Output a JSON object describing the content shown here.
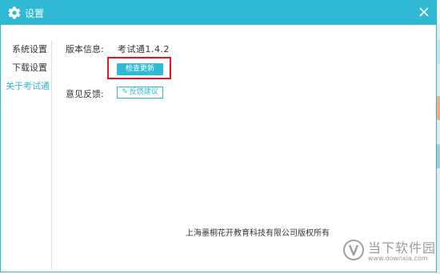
{
  "window": {
    "title": "设置"
  },
  "sidebar": {
    "items": [
      {
        "label": "系统设置",
        "active": false
      },
      {
        "label": "下载设置",
        "active": false
      },
      {
        "label": "关于考试通",
        "active": true
      }
    ]
  },
  "about": {
    "version_label": "版本信息:",
    "version_value": "考试通1.4.2",
    "check_update_label": "检查更新",
    "feedback_label": "意见反馈:",
    "feedback_button_label": "反馈建议",
    "copyright": "上海墨桐花开教育科技有限公司版权所有"
  },
  "watermark": {
    "name": "当下软件园",
    "url": "www.downxia.com"
  },
  "colors": {
    "accent": "#2fb9d4",
    "highlight": "#e5161c"
  },
  "icons": {
    "title": "gear-icon",
    "close": "close-icon",
    "feedback": "pencil-icon"
  }
}
